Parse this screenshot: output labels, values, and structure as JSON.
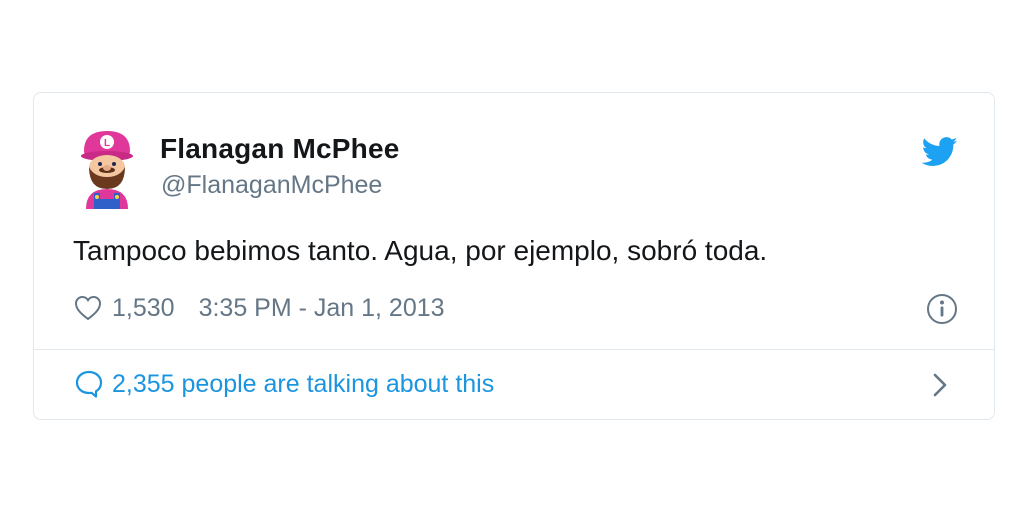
{
  "author": {
    "name": "Flanagan McPhee",
    "handle": "@FlanaganMcPhee"
  },
  "tweet": {
    "text": "Tampoco bebimos tanto. Agua, por ejemplo, sobró toda."
  },
  "meta": {
    "likes": "1,530",
    "timestamp": "3:35 PM - Jan 1, 2013"
  },
  "conversation": {
    "label": "2,355 people are talking about this"
  },
  "icons": {
    "brand": "twitter-bird-icon",
    "like": "heart-icon",
    "info": "info-icon",
    "reply": "speech-bubble-icon",
    "more": "chevron-right-icon"
  },
  "colors": {
    "twitter_blue": "#1da1f2",
    "link_blue": "#1b95e0",
    "text": "#14171a",
    "secondary": "#657786",
    "border": "#e1e8ed",
    "avatar_hat": "#e0389a"
  }
}
